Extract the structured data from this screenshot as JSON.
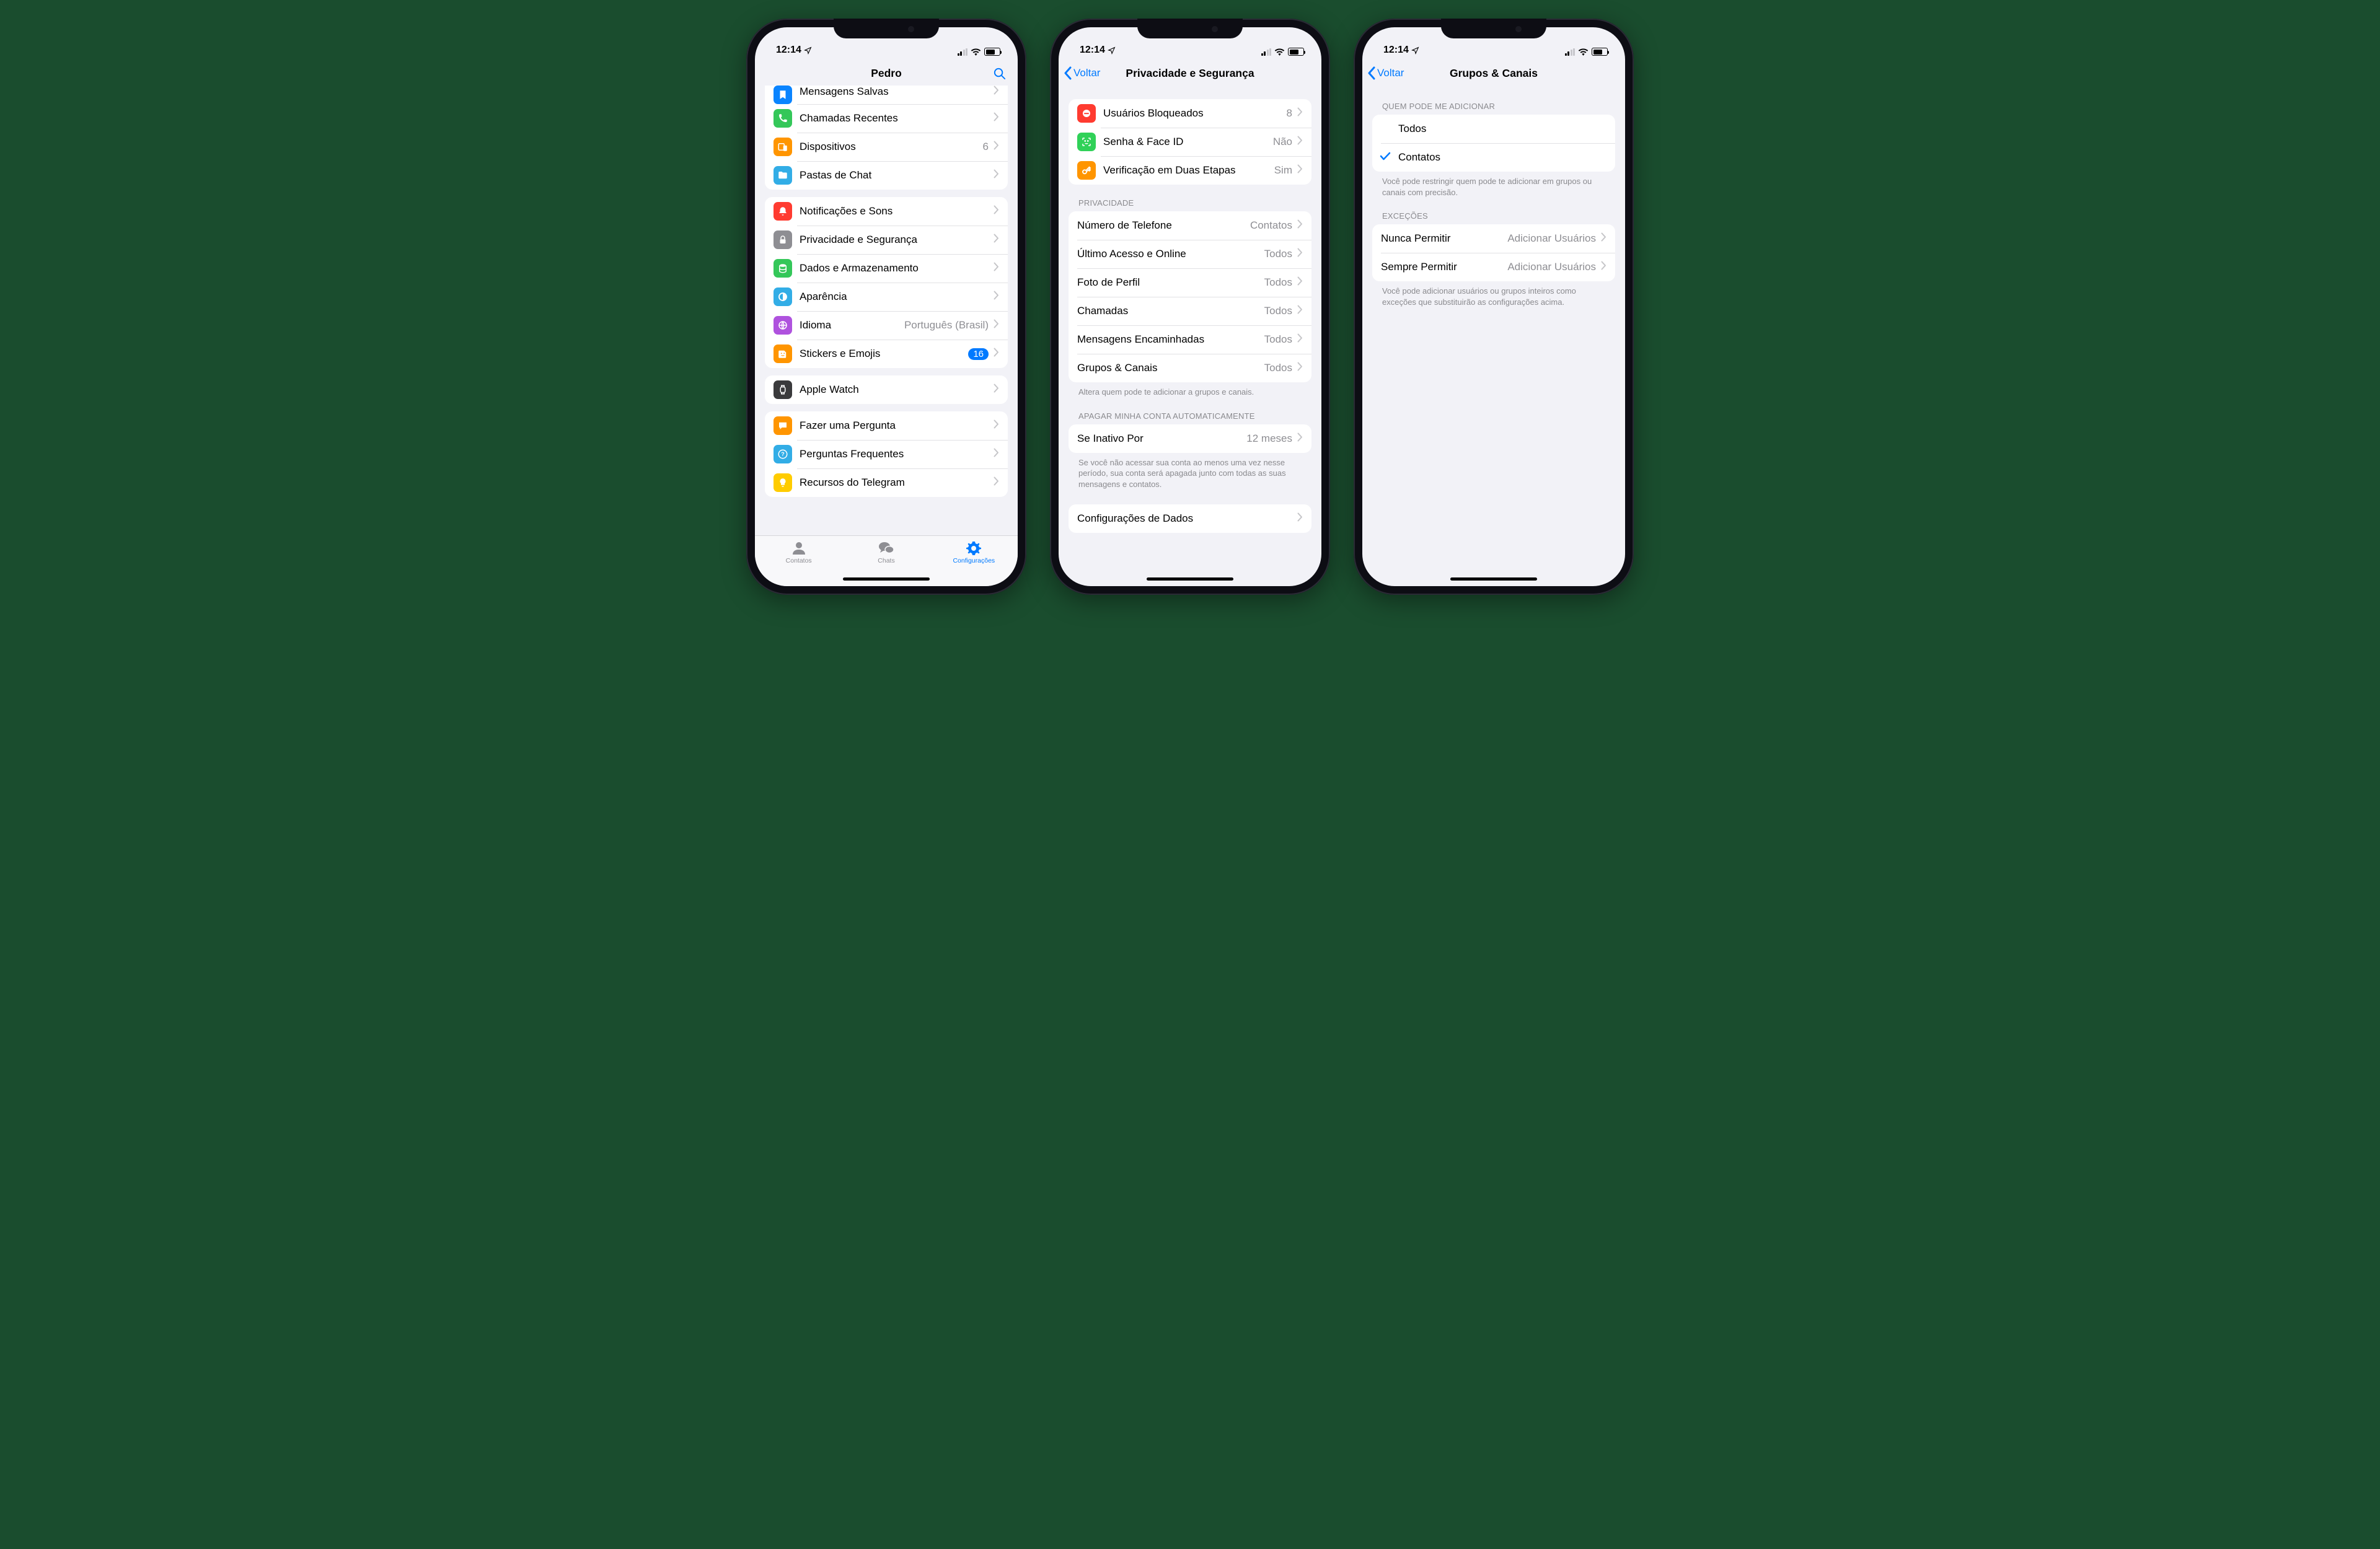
{
  "status": {
    "time": "12:14"
  },
  "phone1": {
    "title": "Pedro",
    "groups": [
      {
        "rows": [
          {
            "icon": "bookmark",
            "bg": "bg-blue",
            "label": "Mensagens Salvas"
          },
          {
            "icon": "phone",
            "bg": "bg-green",
            "label": "Chamadas Recentes"
          },
          {
            "icon": "devices",
            "bg": "bg-orange",
            "label": "Dispositivos",
            "value": "6"
          },
          {
            "icon": "folder",
            "bg": "bg-cyan",
            "label": "Pastas de Chat"
          }
        ]
      },
      {
        "rows": [
          {
            "icon": "bell",
            "bg": "bg-red",
            "label": "Notificações e Sons"
          },
          {
            "icon": "lock",
            "bg": "bg-grey",
            "label": "Privacidade e Segurança"
          },
          {
            "icon": "db",
            "bg": "bg-green",
            "label": "Dados e Armazenamento"
          },
          {
            "icon": "circle",
            "bg": "bg-cyan",
            "label": "Aparência"
          },
          {
            "icon": "globe",
            "bg": "bg-purple",
            "label": "Idioma",
            "value": "Português (Brasil)"
          },
          {
            "icon": "sticker",
            "bg": "bg-orange",
            "label": "Stickers e Emojis",
            "badge": "16"
          }
        ]
      },
      {
        "rows": [
          {
            "icon": "watch",
            "bg": "bg-dark",
            "label": "Apple Watch"
          }
        ]
      },
      {
        "rows": [
          {
            "icon": "chat",
            "bg": "bg-orange",
            "label": "Fazer uma Pergunta"
          },
          {
            "icon": "question",
            "bg": "bg-cyan",
            "label": "Perguntas Frequentes"
          },
          {
            "icon": "bulb",
            "bg": "bg-yellow",
            "label": "Recursos do Telegram"
          }
        ]
      }
    ],
    "tabs": [
      {
        "label": "Contatos"
      },
      {
        "label": "Chats"
      },
      {
        "label": "Configurações"
      }
    ]
  },
  "phone2": {
    "back": "Voltar",
    "title": "Privacidade e Segurança",
    "security_rows": [
      {
        "icon": "block",
        "bg": "bg-red",
        "label": "Usuários Bloqueados",
        "value": "8"
      },
      {
        "icon": "faceid",
        "bg": "bg-lime",
        "label": "Senha & Face ID",
        "value": "Não"
      },
      {
        "icon": "key",
        "bg": "bg-orange",
        "label": "Verificação em Duas Etapas",
        "value": "Sim"
      }
    ],
    "privacy_header": "PRIVACIDADE",
    "privacy_rows": [
      {
        "label": "Número de Telefone",
        "value": "Contatos"
      },
      {
        "label": "Último Acesso e Online",
        "value": "Todos"
      },
      {
        "label": "Foto de Perfil",
        "value": "Todos"
      },
      {
        "label": "Chamadas",
        "value": "Todos"
      },
      {
        "label": "Mensagens Encaminhadas",
        "value": "Todos"
      },
      {
        "label": "Grupos & Canais",
        "value": "Todos"
      }
    ],
    "privacy_footer": "Altera quem pode te adicionar a grupos e canais.",
    "delete_header": "APAGAR MINHA CONTA AUTOMATICAMENTE",
    "delete_row": {
      "label": "Se Inativo Por",
      "value": "12 meses"
    },
    "delete_footer": "Se você não acessar sua conta ao menos uma vez nesse período, sua conta será apagada junto com todas as suas mensagens e contatos.",
    "data_row": {
      "label": "Configurações de Dados"
    }
  },
  "phone3": {
    "back": "Voltar",
    "title": "Grupos & Canais",
    "who_header": "QUEM PODE ME ADICIONAR",
    "who_rows": [
      {
        "label": "Todos",
        "checked": false
      },
      {
        "label": "Contatos",
        "checked": true
      }
    ],
    "who_footer": "Você pode restringir quem pode te adicionar em grupos ou canais com precisão.",
    "exc_header": "EXCEÇÕES",
    "exc_rows": [
      {
        "label": "Nunca Permitir",
        "value": "Adicionar Usuários"
      },
      {
        "label": "Sempre Permitir",
        "value": "Adicionar Usuários"
      }
    ],
    "exc_footer": "Você pode adicionar usuários ou grupos inteiros como exceções que substituirão as configurações acima."
  }
}
